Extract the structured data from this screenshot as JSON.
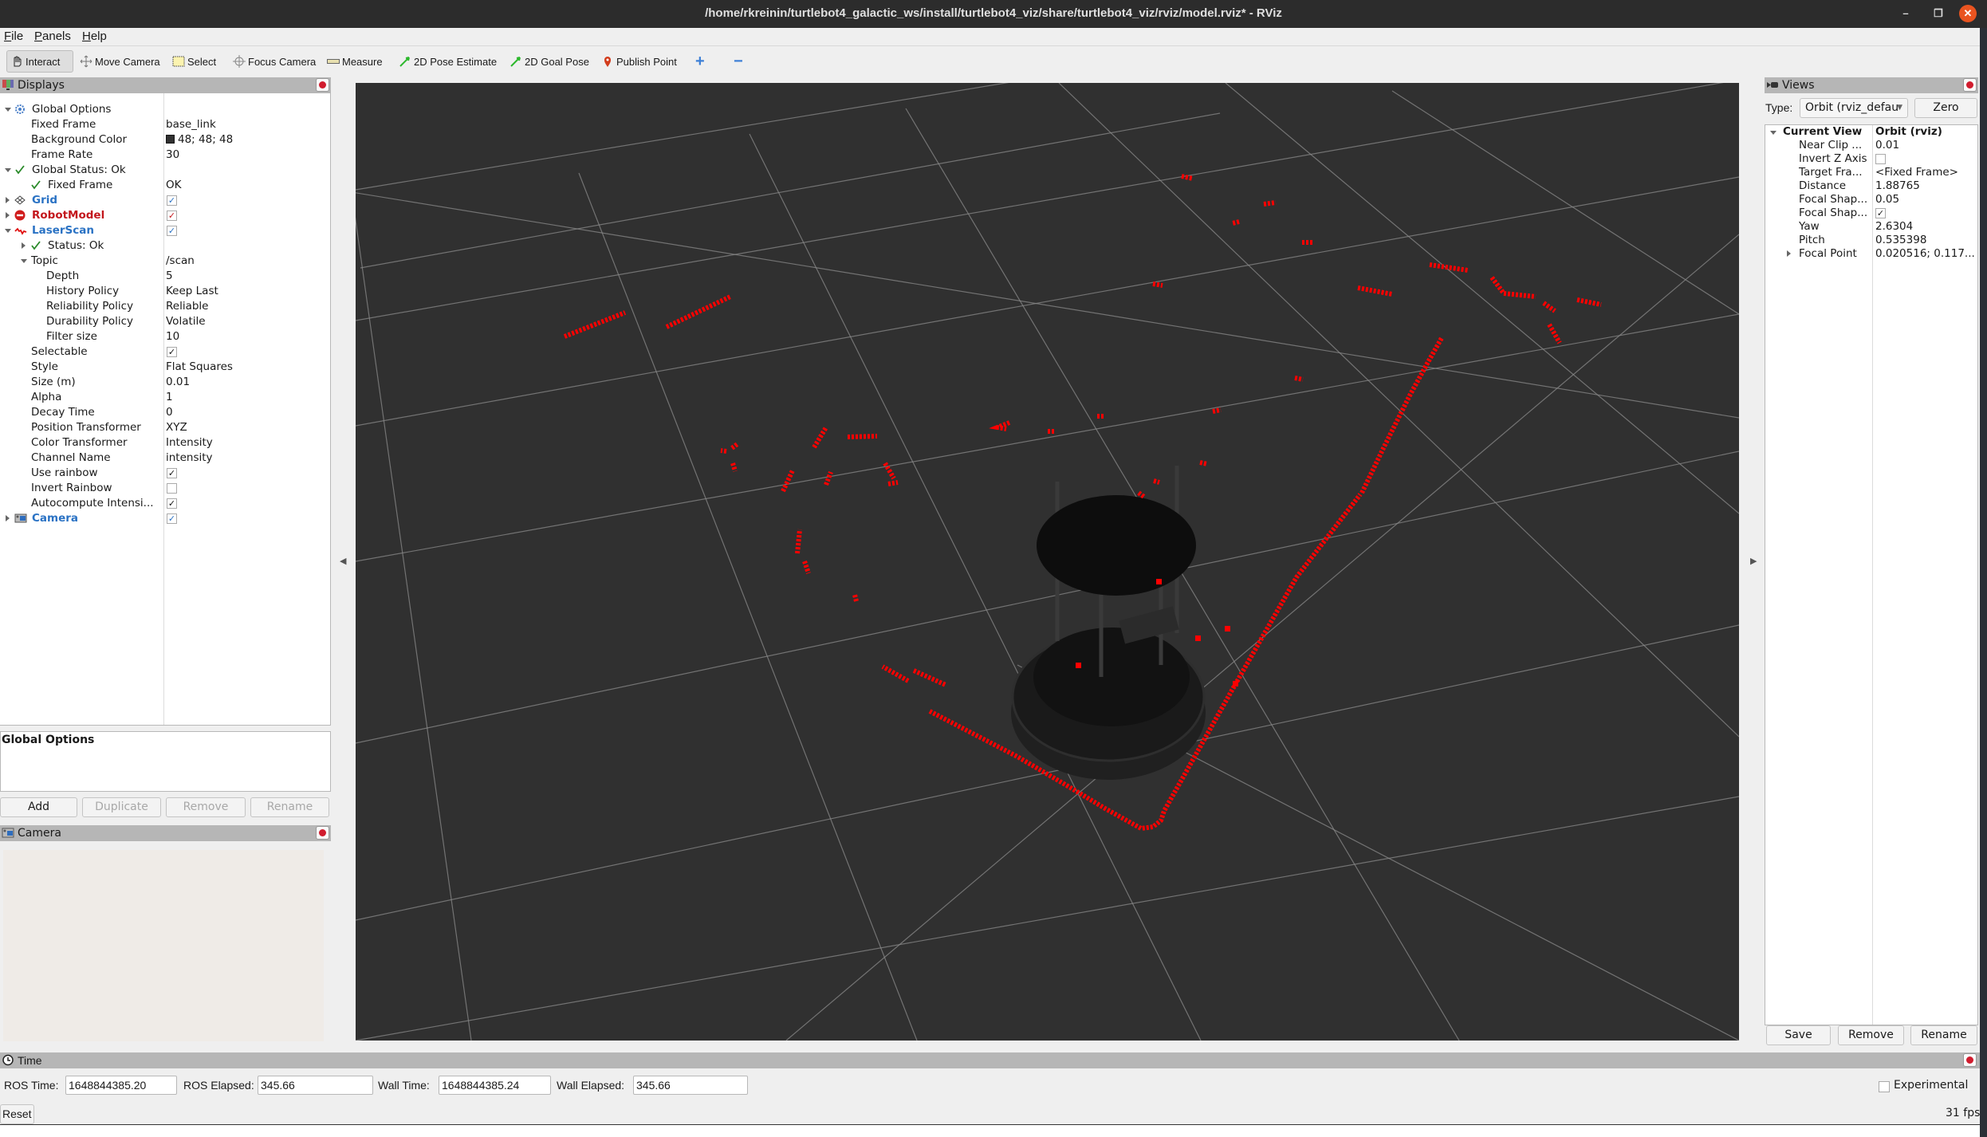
{
  "window": {
    "title": "/home/rkreinin/turtlebot4_galactic_ws/install/turtlebot4_viz/share/turtlebot4_viz/rviz/model.rviz* - RViz",
    "minimize": "–",
    "maximize": "❐",
    "close": "✕"
  },
  "menu": [
    {
      "label": "File",
      "mnemonic": "F",
      "rest": "ile"
    },
    {
      "label": "Panels",
      "mnemonic": "P",
      "rest": "anels"
    },
    {
      "label": "Help",
      "mnemonic": "H",
      "rest": "elp"
    }
  ],
  "toolbar": {
    "tools": [
      {
        "label": "Interact",
        "icon": "hand-pointer-icon",
        "active": true
      },
      {
        "label": "Move Camera",
        "icon": "move-camera-icon"
      },
      {
        "label": "Select",
        "icon": "select-box-icon"
      },
      {
        "label": "Focus Camera",
        "icon": "focus-camera-icon"
      },
      {
        "label": "Measure",
        "icon": "ruler-icon"
      },
      {
        "label": "2D Pose Estimate",
        "icon": "green-arrow-icon"
      },
      {
        "label": "2D Goal Pose",
        "icon": "green-arrow-icon"
      },
      {
        "label": "Publish Point",
        "icon": "map-pin-icon"
      }
    ],
    "add_tool_symbol": "+",
    "remove_tool_symbol": "−"
  },
  "displays": {
    "title": "Displays",
    "rows": [
      {
        "label": "Global Options",
        "value": "",
        "indent": 0,
        "expand": "down",
        "icon": "gear-icon"
      },
      {
        "label": "Fixed Frame",
        "value": "base_link",
        "indent": 1
      },
      {
        "label": "Background Color",
        "value": "48; 48; 48",
        "indent": 1,
        "swatch": "#303030"
      },
      {
        "label": "Frame Rate",
        "value": "30",
        "indent": 1
      },
      {
        "label": "Global Status: Ok",
        "value": "",
        "indent": 0,
        "expand": "down",
        "icon": "check-icon"
      },
      {
        "label": "Fixed Frame",
        "value": "OK",
        "indent": 1,
        "icon": "check-icon"
      },
      {
        "label": "Grid",
        "value": "",
        "indent": 0,
        "expand": "right",
        "icon": "grid-icon",
        "style": "blue",
        "checkbox": true,
        "checked": true
      },
      {
        "label": "RobotModel",
        "value": "",
        "indent": 0,
        "expand": "right",
        "icon": "error-icon",
        "style": "red",
        "checkbox": true,
        "checked": true
      },
      {
        "label": "LaserScan",
        "value": "",
        "indent": 0,
        "expand": "down",
        "icon": "laser-scan-icon",
        "style": "blue",
        "checkbox": true,
        "checked": true
      },
      {
        "label": "Status: Ok",
        "value": "",
        "indent": 1,
        "expand": "right",
        "icon": "check-icon"
      },
      {
        "label": "Topic",
        "value": "/scan",
        "indent": 1,
        "expand": "down"
      },
      {
        "label": "Depth",
        "value": "5",
        "indent": 2
      },
      {
        "label": "History Policy",
        "value": "Keep Last",
        "indent": 2
      },
      {
        "label": "Reliability Policy",
        "value": "Reliable",
        "indent": 2
      },
      {
        "label": "Durability Policy",
        "value": "Volatile",
        "indent": 2
      },
      {
        "label": "Filter size",
        "value": "10",
        "indent": 2
      },
      {
        "label": "Selectable",
        "value": "",
        "indent": 1,
        "checkbox": true,
        "checked": true
      },
      {
        "label": "Style",
        "value": "Flat Squares",
        "indent": 1
      },
      {
        "label": "Size (m)",
        "value": "0.01",
        "indent": 1
      },
      {
        "label": "Alpha",
        "value": "1",
        "indent": 1
      },
      {
        "label": "Decay Time",
        "value": "0",
        "indent": 1
      },
      {
        "label": "Position Transformer",
        "value": "XYZ",
        "indent": 1
      },
      {
        "label": "Color Transformer",
        "value": "Intensity",
        "indent": 1
      },
      {
        "label": "Channel Name",
        "value": "intensity",
        "indent": 1
      },
      {
        "label": "Use rainbow",
        "value": "",
        "indent": 1,
        "checkbox": true,
        "checked": true
      },
      {
        "label": "Invert Rainbow",
        "value": "",
        "indent": 1,
        "checkbox": true,
        "checked": false
      },
      {
        "label": "Autocompute Intensi...",
        "value": "",
        "indent": 1,
        "checkbox": true,
        "checked": true
      },
      {
        "label": "Camera",
        "value": "",
        "indent": 0,
        "expand": "right",
        "icon": "camera-icon",
        "style": "blue",
        "checkbox": true,
        "checked": true
      }
    ],
    "description_title": "Global Options",
    "buttons": {
      "add": "Add",
      "duplicate": "Duplicate",
      "remove": "Remove",
      "rename": "Rename"
    }
  },
  "camera_panel": {
    "title": "Camera"
  },
  "views": {
    "title": "Views",
    "type_label": "Type:",
    "type_value": "Orbit (rviz_defau",
    "zero_button": "Zero",
    "current_view_label": "Current View",
    "current_view_value": "Orbit (rviz)",
    "rows": [
      {
        "label": "Near Clip ...",
        "value": "0.01"
      },
      {
        "label": "Invert Z Axis",
        "value": "",
        "checkbox": true,
        "checked": false
      },
      {
        "label": "Target Fra...",
        "value": "<Fixed Frame>"
      },
      {
        "label": "Distance",
        "value": "1.88765"
      },
      {
        "label": "Focal Shap...",
        "value": "0.05"
      },
      {
        "label": "Focal Shap...",
        "value": "",
        "checkbox": true,
        "checked": true
      },
      {
        "label": "Yaw",
        "value": "2.6304"
      },
      {
        "label": "Pitch",
        "value": "0.535398"
      },
      {
        "label": "Focal Point",
        "value": "0.020516; 0.117...",
        "expand": "right"
      }
    ],
    "buttons": {
      "save": "Save",
      "remove": "Remove",
      "rename": "Rename"
    }
  },
  "time_panel": {
    "title": "Time",
    "ros_time_label": "ROS Time:",
    "ros_time": "1648844385.20",
    "ros_elapsed_label": "ROS Elapsed:",
    "ros_elapsed": "345.66",
    "wall_time_label": "Wall Time:",
    "wall_time": "1648844385.24",
    "wall_elapsed_label": "Wall Elapsed:",
    "wall_elapsed": "345.66",
    "experimental_label": "Experimental",
    "experimental_checked": false,
    "reset_button": "Reset",
    "fps": "31 fps"
  },
  "viewport": {
    "background_color": "#303030",
    "grid_color": "#8a8a8a",
    "scan_color": "#ff0000",
    "robot_color": "#101010"
  }
}
